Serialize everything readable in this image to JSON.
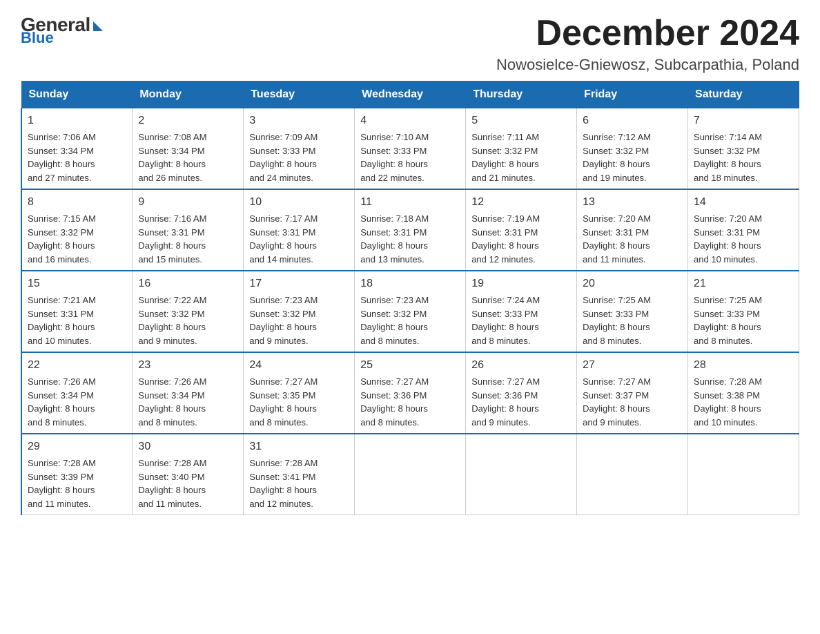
{
  "logo": {
    "general": "General",
    "blue": "Blue"
  },
  "header": {
    "month_title": "December 2024",
    "location": "Nowosielce-Gniewosz, Subcarpathia, Poland"
  },
  "days_of_week": [
    "Sunday",
    "Monday",
    "Tuesday",
    "Wednesday",
    "Thursday",
    "Friday",
    "Saturday"
  ],
  "weeks": [
    [
      {
        "day": "1",
        "sunrise": "7:06 AM",
        "sunset": "3:34 PM",
        "daylight": "8 hours and 27 minutes."
      },
      {
        "day": "2",
        "sunrise": "7:08 AM",
        "sunset": "3:34 PM",
        "daylight": "8 hours and 26 minutes."
      },
      {
        "day": "3",
        "sunrise": "7:09 AM",
        "sunset": "3:33 PM",
        "daylight": "8 hours and 24 minutes."
      },
      {
        "day": "4",
        "sunrise": "7:10 AM",
        "sunset": "3:33 PM",
        "daylight": "8 hours and 22 minutes."
      },
      {
        "day": "5",
        "sunrise": "7:11 AM",
        "sunset": "3:32 PM",
        "daylight": "8 hours and 21 minutes."
      },
      {
        "day": "6",
        "sunrise": "7:12 AM",
        "sunset": "3:32 PM",
        "daylight": "8 hours and 19 minutes."
      },
      {
        "day": "7",
        "sunrise": "7:14 AM",
        "sunset": "3:32 PM",
        "daylight": "8 hours and 18 minutes."
      }
    ],
    [
      {
        "day": "8",
        "sunrise": "7:15 AM",
        "sunset": "3:32 PM",
        "daylight": "8 hours and 16 minutes."
      },
      {
        "day": "9",
        "sunrise": "7:16 AM",
        "sunset": "3:31 PM",
        "daylight": "8 hours and 15 minutes."
      },
      {
        "day": "10",
        "sunrise": "7:17 AM",
        "sunset": "3:31 PM",
        "daylight": "8 hours and 14 minutes."
      },
      {
        "day": "11",
        "sunrise": "7:18 AM",
        "sunset": "3:31 PM",
        "daylight": "8 hours and 13 minutes."
      },
      {
        "day": "12",
        "sunrise": "7:19 AM",
        "sunset": "3:31 PM",
        "daylight": "8 hours and 12 minutes."
      },
      {
        "day": "13",
        "sunrise": "7:20 AM",
        "sunset": "3:31 PM",
        "daylight": "8 hours and 11 minutes."
      },
      {
        "day": "14",
        "sunrise": "7:20 AM",
        "sunset": "3:31 PM",
        "daylight": "8 hours and 10 minutes."
      }
    ],
    [
      {
        "day": "15",
        "sunrise": "7:21 AM",
        "sunset": "3:31 PM",
        "daylight": "8 hours and 10 minutes."
      },
      {
        "day": "16",
        "sunrise": "7:22 AM",
        "sunset": "3:32 PM",
        "daylight": "8 hours and 9 minutes."
      },
      {
        "day": "17",
        "sunrise": "7:23 AM",
        "sunset": "3:32 PM",
        "daylight": "8 hours and 9 minutes."
      },
      {
        "day": "18",
        "sunrise": "7:23 AM",
        "sunset": "3:32 PM",
        "daylight": "8 hours and 8 minutes."
      },
      {
        "day": "19",
        "sunrise": "7:24 AM",
        "sunset": "3:33 PM",
        "daylight": "8 hours and 8 minutes."
      },
      {
        "day": "20",
        "sunrise": "7:25 AM",
        "sunset": "3:33 PM",
        "daylight": "8 hours and 8 minutes."
      },
      {
        "day": "21",
        "sunrise": "7:25 AM",
        "sunset": "3:33 PM",
        "daylight": "8 hours and 8 minutes."
      }
    ],
    [
      {
        "day": "22",
        "sunrise": "7:26 AM",
        "sunset": "3:34 PM",
        "daylight": "8 hours and 8 minutes."
      },
      {
        "day": "23",
        "sunrise": "7:26 AM",
        "sunset": "3:34 PM",
        "daylight": "8 hours and 8 minutes."
      },
      {
        "day": "24",
        "sunrise": "7:27 AM",
        "sunset": "3:35 PM",
        "daylight": "8 hours and 8 minutes."
      },
      {
        "day": "25",
        "sunrise": "7:27 AM",
        "sunset": "3:36 PM",
        "daylight": "8 hours and 8 minutes."
      },
      {
        "day": "26",
        "sunrise": "7:27 AM",
        "sunset": "3:36 PM",
        "daylight": "8 hours and 9 minutes."
      },
      {
        "day": "27",
        "sunrise": "7:27 AM",
        "sunset": "3:37 PM",
        "daylight": "8 hours and 9 minutes."
      },
      {
        "day": "28",
        "sunrise": "7:28 AM",
        "sunset": "3:38 PM",
        "daylight": "8 hours and 10 minutes."
      }
    ],
    [
      {
        "day": "29",
        "sunrise": "7:28 AM",
        "sunset": "3:39 PM",
        "daylight": "8 hours and 11 minutes."
      },
      {
        "day": "30",
        "sunrise": "7:28 AM",
        "sunset": "3:40 PM",
        "daylight": "8 hours and 11 minutes."
      },
      {
        "day": "31",
        "sunrise": "7:28 AM",
        "sunset": "3:41 PM",
        "daylight": "8 hours and 12 minutes."
      },
      null,
      null,
      null,
      null
    ]
  ],
  "labels": {
    "sunrise": "Sunrise:",
    "sunset": "Sunset:",
    "daylight": "Daylight:"
  }
}
